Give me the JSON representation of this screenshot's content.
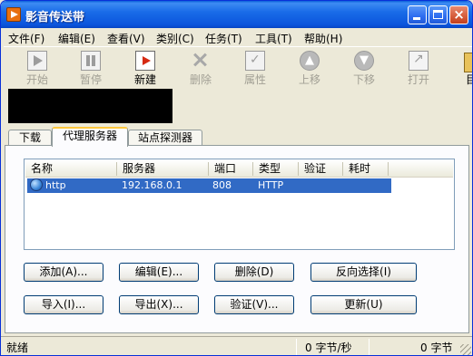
{
  "window": {
    "title": "影音传送带"
  },
  "menu": [
    "文件(F)",
    "编辑(E)",
    "查看(V)",
    "类别(C)",
    "任务(T)",
    "工具(T)",
    "帮助(H)"
  ],
  "toolbar": {
    "start": "开始",
    "pause": "暂停",
    "new": "新建",
    "delete": "删除",
    "properties": "属性",
    "move_up": "上移",
    "move_down": "下移",
    "open": "打开",
    "partial": "目"
  },
  "tabs": [
    "下载",
    "代理服务器",
    "站点探测器"
  ],
  "proxy_list": {
    "columns": [
      "名称",
      "服务器",
      "端口",
      "类型",
      "验证",
      "耗时"
    ],
    "rows": [
      {
        "name": "http",
        "server": "192.168.0.1",
        "port": "808",
        "type": "HTTP",
        "auth": "",
        "time": ""
      }
    ]
  },
  "buttons": {
    "add": "添加(A)...",
    "edit": "编辑(E)...",
    "delete": "删除(D)",
    "invert_select": "反向选择(I)",
    "import": "导入(I)...",
    "export": "导出(X)...",
    "verify": "验证(V)...",
    "update": "更新(U)"
  },
  "status": {
    "left": "就绪",
    "speed": "0 字节/秒",
    "total": "0 字节"
  }
}
